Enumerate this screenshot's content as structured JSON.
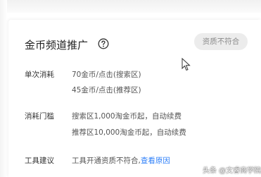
{
  "card": {
    "title": "金币频道推广",
    "help_icon": "question-circle-icon",
    "status_badge": "资质不符合"
  },
  "rows": [
    {
      "label": "单次消耗",
      "values": [
        "70金币/点击(搜索区)",
        "45金币/点击(推荐区)"
      ]
    },
    {
      "label": "消耗门槛",
      "values": [
        "搜索区1,000淘金币起，自动续费",
        "推荐区10,000淘金币起，自动续费"
      ]
    },
    {
      "label": "工具建议",
      "text": "工具开通资质不符合,",
      "link": "查看原因"
    }
  ],
  "watermark": "头条 @文睿商学院",
  "colors": {
    "link": "#2d7ff9",
    "badge_bg": "#ececec",
    "badge_text": "#8a8a8a"
  }
}
